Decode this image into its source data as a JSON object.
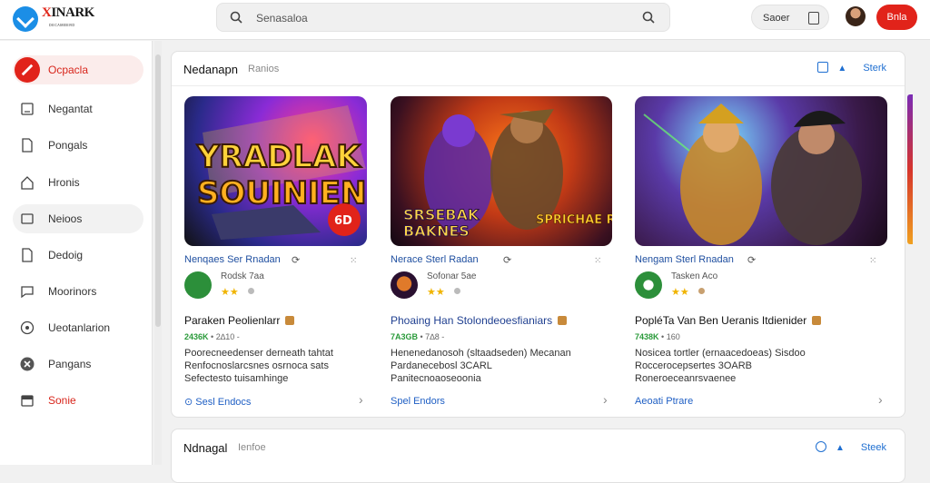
{
  "logo": {
    "mark": "X",
    "name": "INARK",
    "tagline": "ᴅᴇᴄᴀᴍʙᴇʀᴅ"
  },
  "search": {
    "placeholder": "Senasaloa"
  },
  "header": {
    "saver_label": "Saoer",
    "primary_button": "Bnla"
  },
  "sidebar": {
    "items": [
      {
        "label": "Ocpacla",
        "icon": "pencil-icon"
      },
      {
        "label": "Negantat",
        "icon": "document-icon"
      },
      {
        "label": "Pongals",
        "icon": "page-icon"
      },
      {
        "label": "Hronis",
        "icon": "home-icon"
      },
      {
        "label": "Neioos",
        "icon": "chat-icon"
      },
      {
        "label": "Dedoig",
        "icon": "file-icon"
      },
      {
        "label": "Moorinors",
        "icon": "message-icon"
      },
      {
        "label": "Ueotanlarion",
        "icon": "disc-icon"
      },
      {
        "label": "Pangans",
        "icon": "close-circle-icon"
      },
      {
        "label": "Sonie",
        "icon": "tray-icon"
      }
    ]
  },
  "section1": {
    "title": "Nedanapn",
    "subtitle": "Ranios",
    "control": "Sterk"
  },
  "section2": {
    "title": "Ndnagal",
    "subtitle": "Ienfoe",
    "control": "Steek"
  },
  "games": [
    {
      "thumb_line1": "YRADLAK",
      "thumb_line2": "SOUINIEN",
      "thumb_badge": "6D",
      "meta": "Nenqaes Ser Rnadan",
      "dev_name": "Rodsk 7aa",
      "title": "Paraken Peolienlarr",
      "price": "2436K",
      "price_note": "• 2∆10 -",
      "desc_lines": [
        "Poorecneedenser derneath tahtat",
        "Renfocnoslarcsnes osrnoca sats",
        "Sefectesto tuisamhinge"
      ],
      "action": "Sesl Endocs"
    },
    {
      "thumb_line1": "SRSEBAK",
      "thumb_line2": "BAKNES",
      "thumb_badge": "SPRICHAE RCAS!",
      "meta": "Nerace Sterl Radan",
      "dev_name": "Sofonar 5ae",
      "title": "Phoaing Han Stolondeoesfianiars",
      "price": "7A3GB",
      "price_note": "• 7∆8 -",
      "desc_lines": [
        "Henenedanosoh (sltaadseden) Mecanan",
        "Pardanecebosl 3CARL",
        "Panitecnoaoseoonia"
      ],
      "action": "Spel Endors"
    },
    {
      "thumb_line1": "",
      "thumb_line2": "",
      "thumb_badge": "",
      "meta": "Nengam Sterl Rnadan",
      "dev_name": "Tasken Aco",
      "title": "PopléTa Van Ben Ueranis Itdienider",
      "price": "7438K",
      "price_note": "• 160",
      "desc_lines": [
        "Nosicea tortler (ernaacedoeas) Sisdoo",
        "Roccerocepsertes 3OARB",
        "Roneroeceanrsvaenee"
      ],
      "action": "Aeoati Ptrare"
    }
  ],
  "colors": {
    "accent": "#e1231a",
    "link": "#1f6fd1",
    "price": "#2a9a3a"
  }
}
